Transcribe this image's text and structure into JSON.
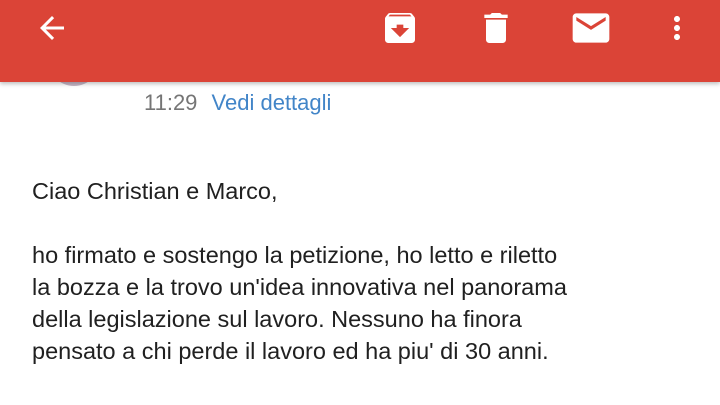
{
  "toolbar": {
    "back_icon": "arrow-left-icon",
    "archive_icon": "archive-icon",
    "delete_icon": "trash-icon",
    "mail_icon": "envelope-icon",
    "more_icon": "more-vertical-icon",
    "background_color": "#db4437"
  },
  "header": {
    "time": "11:29",
    "details_link": "Vedi dettagli"
  },
  "message": {
    "greeting": "Ciao Christian e Marco,",
    "paragraph_lines": [
      "ho firmato e sostengo la petizione, ho letto e riletto",
      "la bozza e la trovo un'idea innovativa nel panorama",
      "della legislazione sul lavoro. Nessuno ha finora",
      "pensato a chi perde il lavoro ed ha piu' di 30 anni."
    ]
  }
}
